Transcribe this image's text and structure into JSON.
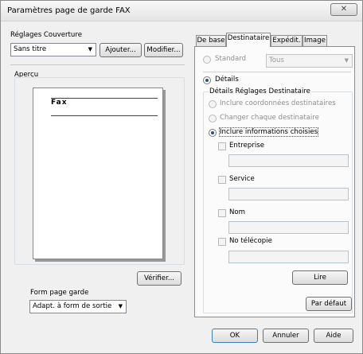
{
  "window": {
    "title": "Paramètres page de garde FAX",
    "close_label": "✕"
  },
  "cover": {
    "label": "Réglages Couverture",
    "selected": "Sans titre",
    "add_button": "Ajouter...",
    "modify_button": "Modifier..."
  },
  "preview": {
    "label": "Aperçu",
    "page_text": "Fax",
    "verify_button": "Vérifier..."
  },
  "page_form": {
    "label": "Form page garde",
    "selected": "Adapt. à form de sortie"
  },
  "tabs": [
    {
      "label": "De base"
    },
    {
      "label": "Destinataire"
    },
    {
      "label": "Expédit."
    },
    {
      "label": "Image"
    }
  ],
  "destinataire": {
    "standard_label": "Standard",
    "standard_select": "Tous",
    "details_label": "Détails",
    "group_title": "Détails Réglages Destinataire",
    "options": [
      "Inclure coordonnées destinataires",
      "Changer chaque destinataire",
      "Inclure informations choisies"
    ],
    "fields": [
      {
        "label": "Entreprise"
      },
      {
        "label": "Service"
      },
      {
        "label": "Nom"
      },
      {
        "label": "No télécopie"
      }
    ],
    "read_button": "Lire",
    "default_button": "Par défaut"
  },
  "footer": {
    "ok": "OK",
    "cancel": "Annuler",
    "help": "Aide"
  }
}
